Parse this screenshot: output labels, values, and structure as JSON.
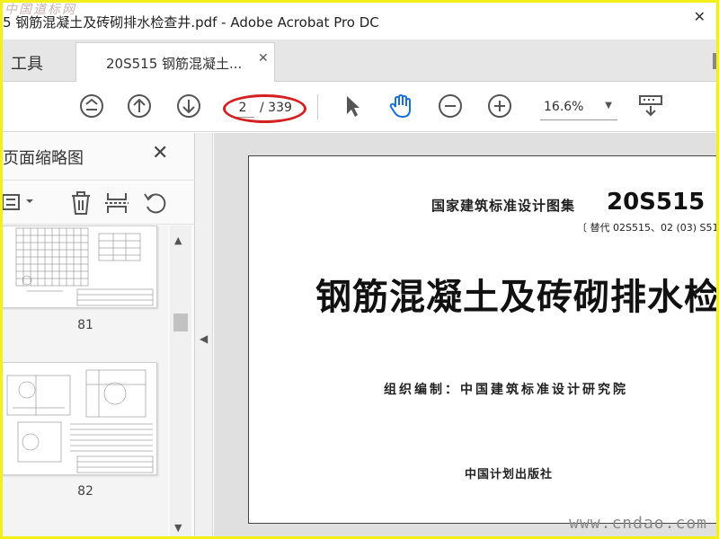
{
  "window": {
    "title": "5 钢筋混凝土及砖砌排水检查井.pdf - Adobe Acrobat Pro DC",
    "close_glyph": "✕",
    "watermark_top": "中国道标网"
  },
  "tabs": {
    "tools_label": "工具",
    "doc_label": "20S515 钢筋混凝土...",
    "doc_close_glyph": "✕"
  },
  "toolbar": {
    "current_page": "2",
    "total_pages": "/ 339",
    "zoom": "16.6%",
    "zoom_caret": "▼",
    "icons": [
      "first-page-icon",
      "prev-page-icon",
      "next-page-icon",
      "select-arrow-icon",
      "hand-tool-icon",
      "zoom-out-icon",
      "zoom-in-icon",
      "keyboard-icon"
    ],
    "hand_active_color": "#1a6fd6"
  },
  "thumbnails_panel": {
    "title": "页面缩略图",
    "close_glyph": "✕",
    "tools": [
      "options-menu-icon",
      "delete-icon",
      "extract-icon",
      "rotate-icon"
    ],
    "items": [
      {
        "label": "81"
      },
      {
        "label": "82"
      }
    ]
  },
  "scroll": {
    "up_glyph": "▲",
    "down_glyph": "▼",
    "collapse_glyph": "◀"
  },
  "document_page": {
    "series": "国家建筑标准设计图集",
    "code": "20S515",
    "replaces": "〔 替代  02S515、02 (03) S51",
    "title": "钢筋混凝土及砖砌排水检查井",
    "org": "组织编制：中国建筑标准设计研究院",
    "publisher": "中国计划出版社"
  },
  "watermark_bottom": "www.cndao.com",
  "colors": {
    "frame": "#f2ef1c",
    "highlight_ring": "#d42020"
  }
}
